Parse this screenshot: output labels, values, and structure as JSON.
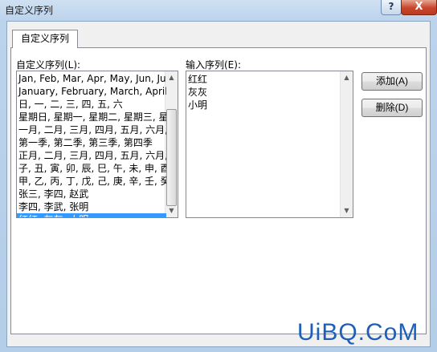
{
  "window": {
    "title": "自定义序列",
    "help_label": "?",
    "close_label": "X"
  },
  "tab": {
    "label": "自定义序列"
  },
  "custom_lists": {
    "label": "自定义序列(L):",
    "items": [
      "Jan, Feb, Mar, Apr, May, Jun, Ju",
      "January, February, March, April,",
      "日, 一, 二, 三, 四, 五, 六",
      "星期日, 星期一, 星期二, 星期三, 星",
      "一月, 二月, 三月, 四月, 五月, 六月,",
      "第一季, 第二季, 第三季, 第四季",
      "正月, 二月, 三月, 四月, 五月, 六月,",
      "子, 丑, 寅, 卯, 辰, 巳, 午, 未, 申, 酉",
      "甲, 乙, 丙, 丁, 戊, 己, 庚, 辛, 壬, 癸",
      "张三, 李四, 赵武",
      "李四, 李武, 张明",
      "红红, 灰灰, 小明"
    ],
    "selected_index": 11
  },
  "input_list": {
    "label": "输入序列(E):",
    "lines": [
      "红红",
      "灰灰",
      "小明"
    ]
  },
  "buttons": {
    "add": "添加(A)",
    "delete": "删除(D)"
  },
  "watermark": {
    "text": "UiBQ.CoM"
  }
}
